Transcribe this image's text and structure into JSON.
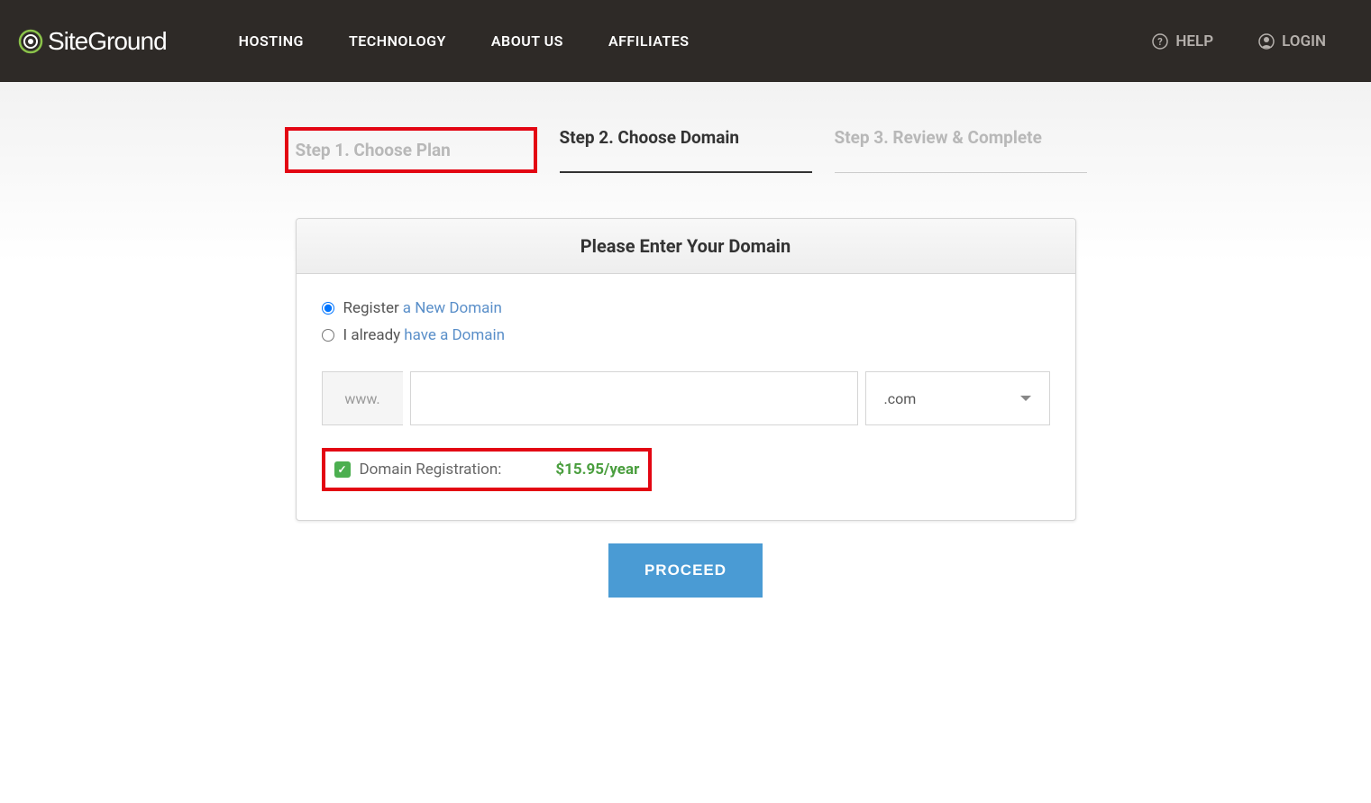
{
  "header": {
    "logo_text": "SiteGround",
    "nav": {
      "hosting": "HOSTING",
      "technology": "TECHNOLOGY",
      "about": "ABOUT US",
      "affiliates": "AFFILIATES"
    },
    "help": "HELP",
    "login": "LOGIN"
  },
  "steps": {
    "step1": "Step 1. Choose Plan",
    "step2": "Step 2. Choose Domain",
    "step3": "Step 3. Review & Complete"
  },
  "card": {
    "title": "Please Enter Your Domain",
    "radio_register_prefix": "Register",
    "radio_register_link": "a New Domain",
    "radio_have_prefix": "I already",
    "radio_have_link": "have a Domain",
    "www_label": "www.",
    "domain_value": "",
    "tld_value": ".com",
    "registration_label": "Domain Registration:",
    "registration_price": "$15.95/year"
  },
  "proceed_label": "PROCEED"
}
